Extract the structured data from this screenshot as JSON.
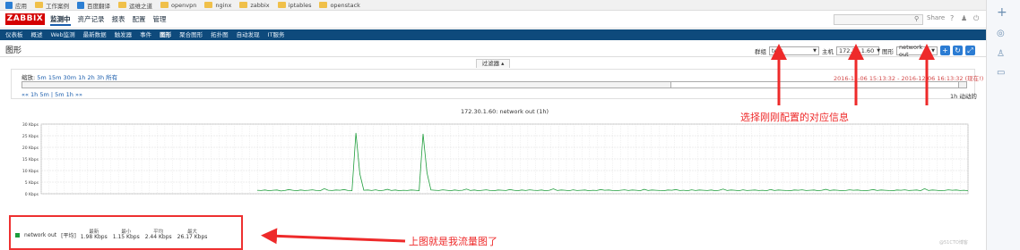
{
  "bookmarks": [
    {
      "icon": "star-icon",
      "label": "应用"
    },
    {
      "icon": "folder-icon",
      "label": "工作案例"
    },
    {
      "icon": "translate-icon",
      "label": "百度翻译"
    },
    {
      "icon": "folder-icon",
      "label": "运维之道"
    },
    {
      "icon": "folder-icon",
      "label": "openvpn"
    },
    {
      "icon": "folder-icon",
      "label": "nginx"
    },
    {
      "icon": "folder-icon",
      "label": "zabbix"
    },
    {
      "icon": "folder-icon",
      "label": "iptables"
    },
    {
      "icon": "folder-icon",
      "label": "openstack"
    }
  ],
  "header": {
    "logo": "ZABBIX",
    "menu": [
      "监测中",
      "资产记录",
      "报表",
      "配置",
      "管理"
    ],
    "share": "Share",
    "help": "?",
    "user": "♟",
    "power": "⏻"
  },
  "submenu": [
    "仪表板",
    "概述",
    "Web监测",
    "最新数据",
    "触发器",
    "事件",
    "图形",
    "聚合图形",
    "拓扑图",
    "自动发现",
    "IT服务"
  ],
  "page": {
    "title": "图形",
    "group_label": "群组",
    "group_value": "test",
    "host_label": "主机",
    "host_value": "172.30.1.60",
    "graph_label": "图形",
    "graph_value": "network out"
  },
  "filter": {
    "tab": "过滤器 ▴",
    "zoom_label": "缩放:",
    "zooms": [
      "5m",
      "15m",
      "30m",
      "1h",
      "2h",
      "3h",
      "所有"
    ],
    "range": "2016-12-06 15:13:32 - 2016-12-06 16:13:32 (现在!)",
    "nav": "«« 1h 5m | 5m 1h »»",
    "period": "1h 动动的"
  },
  "chart_data": {
    "type": "line",
    "title": "172.30.1.60: network out (1h)",
    "ylabel": "Kbps",
    "yticks": [
      "30 Kbps",
      "25 Kbps",
      "20 Kbps",
      "15 Kbps",
      "10 Kbps",
      "5 Kbps",
      "0 Kbps"
    ],
    "ylim": [
      0,
      30
    ],
    "xlim": [
      0,
      360
    ],
    "series": [
      {
        "name": "network out",
        "color": "#1e9d3b",
        "values": [
          1.5,
          1.4,
          1.6,
          1.3,
          1.5,
          1.6,
          1.2,
          1.4,
          1.8,
          1.5,
          1.3,
          1.6,
          1.4,
          1.5,
          1.7,
          1.4,
          1.3,
          2.2,
          1.5,
          1.4,
          1.6,
          1.5,
          1.8,
          1.4,
          1.3,
          26.2,
          8.5,
          1.5,
          1.6,
          1.4,
          1.7,
          1.3,
          1.5,
          1.9,
          1.4,
          1.6,
          1.3,
          1.5,
          1.4,
          1.6,
          1.5,
          1.3,
          25.8,
          9.0,
          1.6,
          1.5,
          1.4,
          1.7,
          1.5,
          1.3,
          1.6,
          1.4,
          1.5,
          2.0,
          1.4,
          1.6,
          1.3,
          1.5,
          1.7,
          1.4,
          1.3,
          1.6,
          1.5,
          1.4,
          1.8,
          1.5,
          1.3,
          1.6,
          1.4,
          1.7,
          1.5,
          1.4,
          1.6,
          1.3,
          1.5,
          2.1,
          1.4,
          1.6,
          1.5,
          1.3,
          1.7,
          1.4,
          1.5,
          1.6,
          1.3,
          1.5,
          1.4,
          1.8,
          1.5,
          1.6,
          1.4,
          1.3,
          1.5,
          1.7,
          1.4,
          1.6,
          1.5,
          1.3,
          1.9,
          1.4,
          1.6,
          1.5,
          1.4,
          1.3,
          1.6,
          1.5,
          1.8,
          1.4,
          1.5,
          1.3,
          1.7,
          1.4,
          1.6,
          1.5,
          1.4,
          1.6,
          1.3,
          1.5,
          2.0,
          1.4,
          1.6,
          1.5,
          1.3,
          1.7,
          1.4,
          1.5,
          1.6,
          1.4,
          1.5,
          1.3,
          1.8,
          1.4,
          1.6,
          1.5,
          1.4,
          1.3,
          1.6,
          1.5,
          1.7,
          1.4,
          1.5,
          1.6,
          1.3,
          1.5,
          1.9,
          1.4,
          1.6,
          1.5,
          1.3,
          1.4,
          1.7,
          1.5,
          1.6,
          1.4,
          1.3,
          1.5,
          1.8,
          1.4,
          1.6,
          1.5,
          1.4,
          1.3,
          1.6,
          1.5,
          1.7,
          1.4,
          1.5,
          1.6,
          1.3,
          2.2,
          1.4,
          1.6,
          1.5,
          1.3,
          1.4,
          1.7,
          1.5,
          1.6,
          1.4,
          1.5,
          1.3
        ]
      }
    ],
    "legend": {
      "series": "network out",
      "headers": [
        "最新",
        "最小",
        "平均",
        "最大"
      ],
      "agg": "[平均]",
      "values": [
        "1.98 Kbps",
        "1.15 Kbps",
        "2.44 Kbps",
        "26.17 Kbps"
      ]
    },
    "grid": true
  },
  "annotations": {
    "a1": "选择刚刚配置的对应信息",
    "a2": "上图就是我流量图了"
  },
  "watermark": "@51CTO博客"
}
